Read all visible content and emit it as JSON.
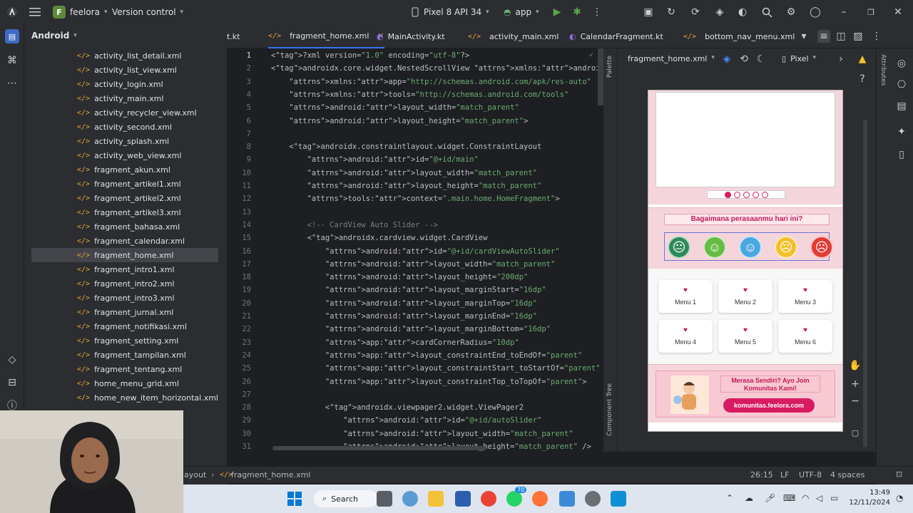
{
  "titlebar": {
    "project_letter": "F",
    "project_name": "feelora",
    "vcs": "Version control",
    "device": "Pixel 8 API 34",
    "run_config": "app"
  },
  "project_panel": {
    "view": "Android",
    "files": [
      "activity_list_detail.xml",
      "activity_list_view.xml",
      "activity_login.xml",
      "activity_main.xml",
      "activity_recycler_view.xml",
      "activity_second.xml",
      "activity_splash.xml",
      "activity_web_view.xml",
      "fragment_akun.xml",
      "fragment_artikel1.xml",
      "fragment_artikel2.xml",
      "fragment_artikel3.xml",
      "fragment_bahasa.xml",
      "fragment_calendar.xml",
      "fragment_home.xml",
      "fragment_intro1.xml",
      "fragment_intro2.xml",
      "fragment_intro3.xml",
      "fragment_jurnal.xml",
      "fragment_notifikasi.xml",
      "fragment_setting.xml",
      "fragment_tampilan.xml",
      "fragment_tentang.xml",
      "home_menu_grid.xml",
      "home_new_item_horizontal.xml"
    ],
    "selected": "fragment_home.xml"
  },
  "tabs": [
    "t.kt",
    "fragment_home.xml",
    "MainActivity.kt",
    "activity_main.xml",
    "CalendarFragment.kt",
    "bottom_nav_menu.xml"
  ],
  "editor": {
    "lines": [
      "<?xml version=\"1.0\" encoding=\"utf-8\"?>",
      "<androidx.core.widget.NestedScrollView xmlns:android=\"http://schemas",
      "    xmlns:app=\"http://schemas.android.com/apk/res-auto\"",
      "    xmlns:tools=\"http://schemas.android.com/tools\"",
      "    android:layout_width=\"match_parent\"",
      "    android:layout_height=\"match_parent\">",
      "",
      "    <androidx.constraintlayout.widget.ConstraintLayout",
      "        android:id=\"@+id/main\"",
      "        android:layout_width=\"match_parent\"",
      "        android:layout_height=\"match_parent\"",
      "        tools:context=\".main.home.HomeFragment\">",
      "",
      "        <!-- CardView Auto Slider -->",
      "        <androidx.cardview.widget.CardView",
      "            android:id=\"@+id/cardViewAutoSlider\"",
      "            android:layout_width=\"match_parent\"",
      "            android:layout_height=\"200dp\"",
      "            android:layout_marginStart=\"16dp\"",
      "            android:layout_marginTop=\"16dp\"",
      "            android:layout_marginEnd=\"16dp\"",
      "            android:layout_marginBottom=\"16dp\"",
      "            app:cardCornerRadius=\"10dp\"",
      "            app:layout_constraintEnd_toEndOf=\"parent\"",
      "            app:layout_constraintStart_toStartOf=\"parent\"",
      "            app:layout_constraintTop_toTopOf=\"parent\">",
      "",
      "            <androidx.viewpager2.widget.ViewPager2",
      "                android:id=\"@+id/autoSlider\"",
      "                android:layout_width=\"match_parent\"",
      "                android:layout_height=\"match_parent\" />"
    ]
  },
  "design": {
    "file": "fragment_home.xml",
    "device": "Pixel",
    "palette": "Palette",
    "component_tree": "Component Tree",
    "attributes": "Attributes",
    "mood_question": "Bagaimana perasaanmu hari ini?",
    "menus": [
      "Menu 1",
      "Menu 2",
      "Menu 3",
      "Menu 4",
      "Menu 5",
      "Menu 6"
    ],
    "community_text": "Merasa Sendiri? Ayo Join Komunitas Kami!",
    "community_button": "komunitas.feelora.com",
    "slider_dots": 5,
    "slider_active": 1,
    "emoji_colors": [
      "#2e8b57",
      "#66bb44",
      "#4aa8e0",
      "#f2c029",
      "#e53935"
    ]
  },
  "statusbar": {
    "breadcrumb_1": "ayout",
    "breadcrumb_2": "fragment_home.xml",
    "position": "26:15",
    "line_sep": "LF",
    "encoding": "UTF-8",
    "indent": "4 spaces"
  },
  "taskbar": {
    "search": "Search",
    "time": "13:49",
    "date": "12/11/2024",
    "whatsapp_badge": "70"
  }
}
